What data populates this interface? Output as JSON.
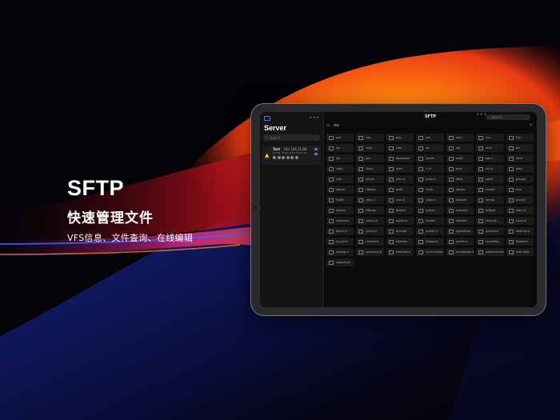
{
  "headline": {
    "title": "SFTP",
    "subtitle": "快速管理文件",
    "description": "VFS信息、文件查询、在线编辑"
  },
  "sidebar": {
    "title": "Server",
    "search_placeholder": "Search",
    "server": {
      "name": "Test",
      "address": "192.168.31.88",
      "date": "Jan 25, 2024 at 10:30:00 AM"
    }
  },
  "main": {
    "title": "SFTP",
    "search_placeholder": "Search",
    "path": "/etc",
    "files": [
      "pve",
      "apt",
      "ppp",
      "ssh",
      "pam",
      "lvm",
      "X11",
      "cgi",
      "ldap",
      "cron",
      "ssl",
      "opt",
      "kmd",
      "sel",
      "ger",
      "gss",
      "apparmor",
      "active",
      "avahi",
      "sgml",
      "xfrce",
      "udev",
      "dbus",
      "alert",
      "rc.d",
      "pma",
      "init.d",
      "pdns",
      "mail",
      "grmat",
      "pam.d",
      "grub.d",
      "fdisk",
      "sasl2",
      "groupp",
      "fsmod",
      "tdeskp",
      "audit",
      "fonts",
      "docker",
      "cmdel",
      "java",
      "fdraft",
      "dbus-1",
      "cron.d",
      "insel.d",
      "ipmpari",
      "kernel",
      "grub.d",
      "deprsh",
      "ifftower",
      "dedest",
      "ndmsc",
      "systemd",
      "default",
      "netrc.d",
      "unbound",
      "claims.d",
      "amsm.d",
      "fsmdlo",
      "nftables",
      "security",
      "sysctl.d",
      "bichle.d",
      "clsmd.d",
      "Iproutel",
      "profile.d",
      "apanishaa",
      "plymouth",
      "depmod.d",
      "my.cnf.d",
      "networks",
      "fail2ban",
      "fdorgauri",
      "profile.d",
      "sysconfig",
      "firewalld",
      "mysttg.d",
      "sendarrix.d",
      "binalftav.d",
      "clusth.shells",
      "rmodprobe.d",
      "pathmanhed",
      "rsffir.shllb",
      "supervisor"
    ]
  },
  "colors": {
    "accent": "#3b82f6",
    "warning": "#f4c430"
  },
  "icons": {
    "sidebar_toggle": "sidebar-toggle-icon",
    "more": "ellipsis-icon",
    "search": "search-icon",
    "home": "home-icon",
    "folder": "folder-icon",
    "warning": "warning-icon",
    "add": "plus-icon"
  }
}
